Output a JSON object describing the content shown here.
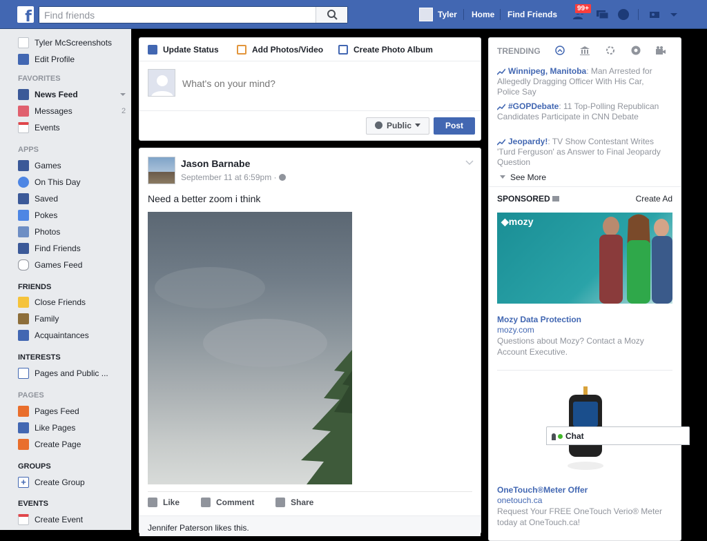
{
  "header": {
    "search_placeholder": "Find friends",
    "user_name": "Tyler",
    "home": "Home",
    "find_friends": "Find Friends",
    "friend_request_badge": "99+",
    "brand_color": "#4267b2"
  },
  "sidebar": {
    "profile_name": "Tyler McScreenshots",
    "edit_profile": "Edit Profile",
    "favorites_heading": "FAVORITES",
    "favorites": [
      {
        "label": "News Feed",
        "icon": "news-feed-icon"
      },
      {
        "label": "Messages",
        "count": "2",
        "icon": "messages-icon"
      },
      {
        "label": "Events",
        "icon": "calendar-icon"
      }
    ],
    "apps_heading": "APPS",
    "apps": [
      {
        "label": "Games",
        "icon": "games-icon"
      },
      {
        "label": "On This Day",
        "icon": "clock-icon"
      },
      {
        "label": "Saved",
        "icon": "bookmark-icon"
      },
      {
        "label": "Pokes",
        "icon": "poke-icon"
      },
      {
        "label": "Photos",
        "icon": "photos-icon"
      },
      {
        "label": "Find Friends",
        "icon": "friends-icon"
      },
      {
        "label": "Games Feed",
        "icon": "controller-icon"
      }
    ],
    "friends_heading": "FRIENDS",
    "friends": [
      {
        "label": "Close Friends",
        "icon": "star-icon"
      },
      {
        "label": "Family",
        "icon": "house-icon"
      },
      {
        "label": "Acquaintances",
        "icon": "list-icon"
      }
    ],
    "interests_heading": "INTERESTS",
    "interests": [
      {
        "label": "Pages and Public ...",
        "icon": "page-icon"
      }
    ],
    "pages_heading": "PAGES",
    "pages": [
      {
        "label": "Pages Feed",
        "icon": "flag-icon"
      },
      {
        "label": "Like Pages",
        "icon": "thumbs-up-icon"
      },
      {
        "label": "Create Page",
        "icon": "create-page-icon"
      }
    ],
    "groups_heading": "GROUPS",
    "groups": [
      {
        "label": "Create Group",
        "icon": "plus-icon"
      }
    ],
    "events_heading": "EVENTS",
    "events": [
      {
        "label": "Create Event",
        "icon": "calendar-plus-icon"
      }
    ]
  },
  "composer": {
    "tabs": [
      "Update Status",
      "Add Photos/Video",
      "Create Photo Album"
    ],
    "placeholder": "What's on your mind?",
    "audience": "Public",
    "post_button": "Post"
  },
  "post": {
    "author": "Jason Barnabe",
    "timestamp": "September 11 at 6:59pm",
    "text": "Need a better zoom i think",
    "actions": [
      "Like",
      "Comment",
      "Share"
    ],
    "likes_text": "Jennifer Paterson likes this."
  },
  "trending": {
    "heading": "TRENDING",
    "items": [
      {
        "topic": "Winnipeg, Manitoba",
        "text": ": Man Arrested for Allegedly Dragging Officer With His Car, Police Say"
      },
      {
        "topic": "#GOPDebate",
        "text": ": 11 Top-Polling Republican Candidates Participate in CNN Debate"
      },
      {
        "topic": "Jeopardy!",
        "text": ": TV Show Contestant Writes 'Turd Ferguson' as Answer to Final Jeopardy Question"
      }
    ],
    "see_more": "See More"
  },
  "sponsored": {
    "heading": "SPONSORED",
    "create_ad": "Create Ad",
    "ads": [
      {
        "brand_logo": "mozy",
        "title": "Mozy Data Protection",
        "domain": "mozy.com",
        "desc": "Questions about Mozy? Contact a Mozy Account Executive."
      },
      {
        "title": "OneTouch®Meter Offer",
        "domain": "onetouch.ca",
        "desc": "Request Your FREE OneTouch Verio® Meter today at OneTouch.ca!"
      }
    ]
  },
  "chat": {
    "label": "Chat"
  }
}
